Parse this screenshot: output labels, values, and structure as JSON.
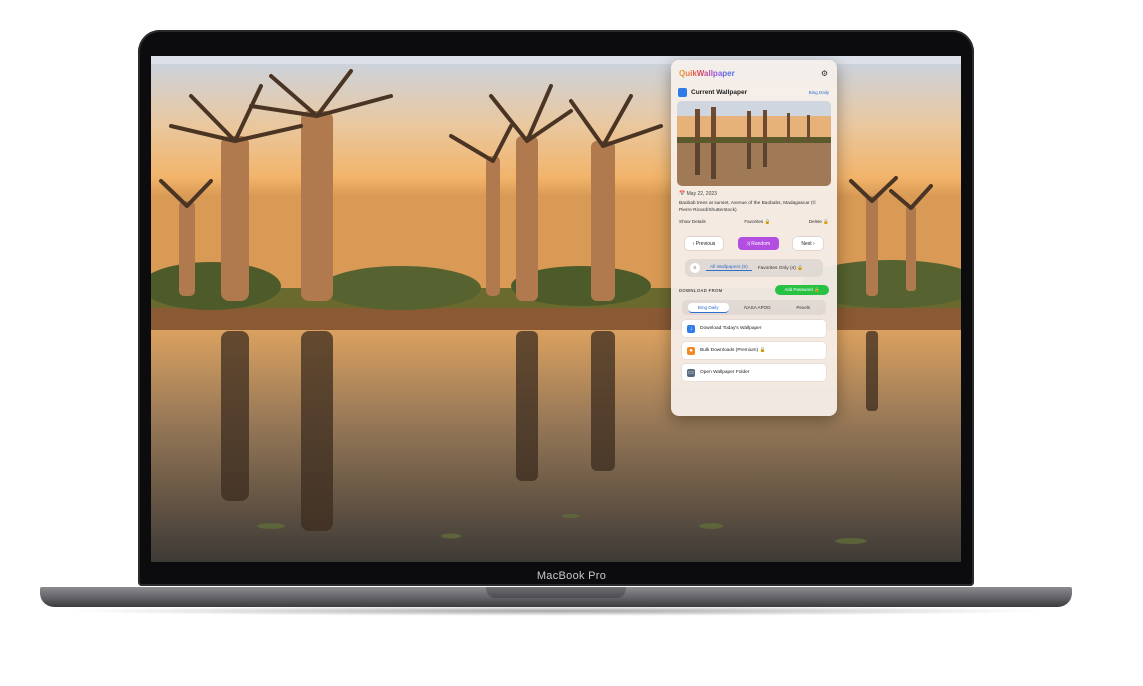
{
  "device": {
    "label": "MacBook Pro"
  },
  "app": {
    "title": "QuikWallpaper",
    "current": {
      "heading": "Current Wallpaper",
      "source_badge": "Bing Daily",
      "date": "May 22, 2023",
      "description": "Baobab trees at sunset, Avenue of the Baobabs, Madagascar (© Pierre Ricard/Shutterstock)",
      "links": [
        "Show Details",
        "Favorites 🔒",
        "Delete 🔒"
      ]
    },
    "nav": {
      "previous": "Previous",
      "random": "Random",
      "next": "Next"
    },
    "filter": {
      "all": "All Wallpapers (5)",
      "favorites": "Favorites Only (4) 🔒"
    },
    "sources": {
      "label": "DOWNLOAD FROM",
      "add_button": "Add Password 🔒",
      "tabs": [
        "Bing Daily",
        "NASA APOD",
        "Pexels"
      ],
      "active_tab": "Bing Daily"
    },
    "actions": [
      {
        "label": "Download Today's Wallpaper",
        "icon": "download-icon",
        "color": "#2f7be8"
      },
      {
        "label": "Bulk Downloads (Premium) 🔒",
        "icon": "bulk-icon",
        "color": "#f08a24"
      },
      {
        "label": "Open Wallpaper Folder",
        "icon": "folder-icon",
        "color": "#5a6b80"
      }
    ]
  },
  "colors": {
    "accent": "#b24ee0",
    "link": "#2f6fd0",
    "success": "#27c244"
  }
}
